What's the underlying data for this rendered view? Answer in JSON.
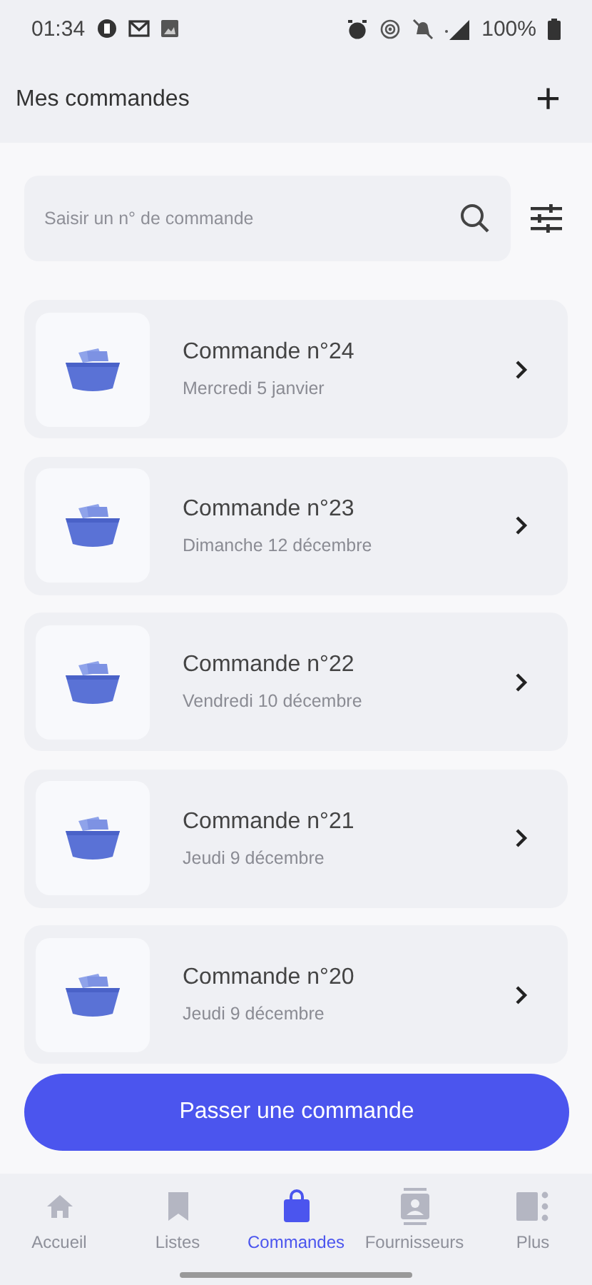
{
  "status_bar": {
    "time": "01:34",
    "battery": "100%"
  },
  "header": {
    "title": "Mes commandes",
    "add_button": "+"
  },
  "search": {
    "placeholder": "Saisir un n° de commande"
  },
  "orders": [
    {
      "title": "Commande n°24",
      "date": "Mercredi 5 janvier"
    },
    {
      "title": "Commande n°23",
      "date": "Dimanche 12 décembre"
    },
    {
      "title": "Commande n°22",
      "date": "Vendredi 10 décembre"
    },
    {
      "title": "Commande n°21",
      "date": "Jeudi 9 décembre"
    },
    {
      "title": "Commande n°20",
      "date": "Jeudi 9 décembre"
    }
  ],
  "primary_button": "Passer une commande",
  "nav": [
    {
      "kind": "home",
      "label": "Accueil",
      "selected": false
    },
    {
      "kind": "lists",
      "label": "Listes",
      "selected": false
    },
    {
      "kind": "orders",
      "label": "Commandes",
      "selected": true
    },
    {
      "kind": "suppliers",
      "label": "Fournisseurs",
      "selected": false
    },
    {
      "kind": "more",
      "label": "Plus",
      "selected": false
    }
  ]
}
